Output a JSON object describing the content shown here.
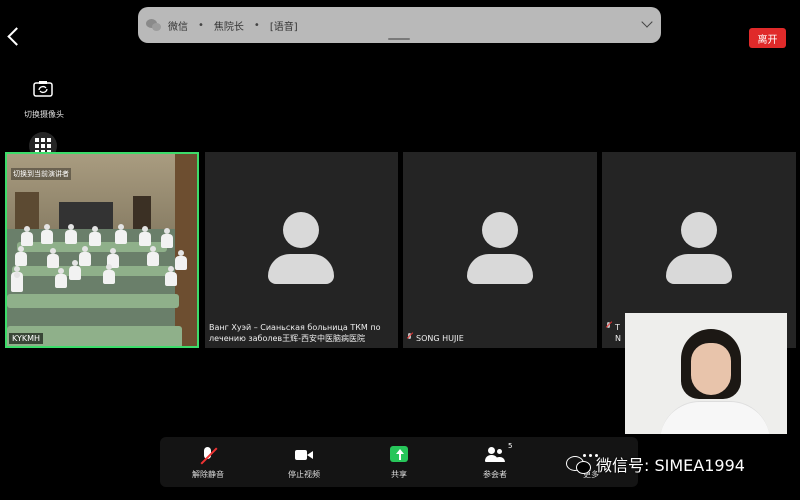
{
  "banner": {
    "app": "微信",
    "sender": "焦院长",
    "message": "[语音]"
  },
  "header": {
    "leave_label": "离开"
  },
  "left_controls": {
    "switch_camera_label": "切换摄像头"
  },
  "tiles": [
    {
      "name": "KYKMH",
      "overlay": "切换到当前演讲者",
      "type": "video"
    },
    {
      "name": "Ванг Хуэй – Сианьская больница ТКМ по лечению заболев王辉-西安中医脑病医院",
      "type": "avatar",
      "muted": false
    },
    {
      "name": "SONG HUJIE",
      "type": "avatar",
      "muted": true
    },
    {
      "name_visible": "T",
      "name_visible_2": "N",
      "type": "avatar",
      "muted": true
    }
  ],
  "toolbar": {
    "unmute_label": "解除静音",
    "stop_video_label": "停止视频",
    "share_label": "共享",
    "participants_label": "参会者",
    "participants_count": "5",
    "more_label": "更多"
  },
  "watermark": {
    "text": "微信号: SIMEA1994"
  },
  "colors": {
    "leave_button": "#e02a2a",
    "active_speaker_border": "#3ddc6a",
    "share_icon": "#27c65a"
  }
}
